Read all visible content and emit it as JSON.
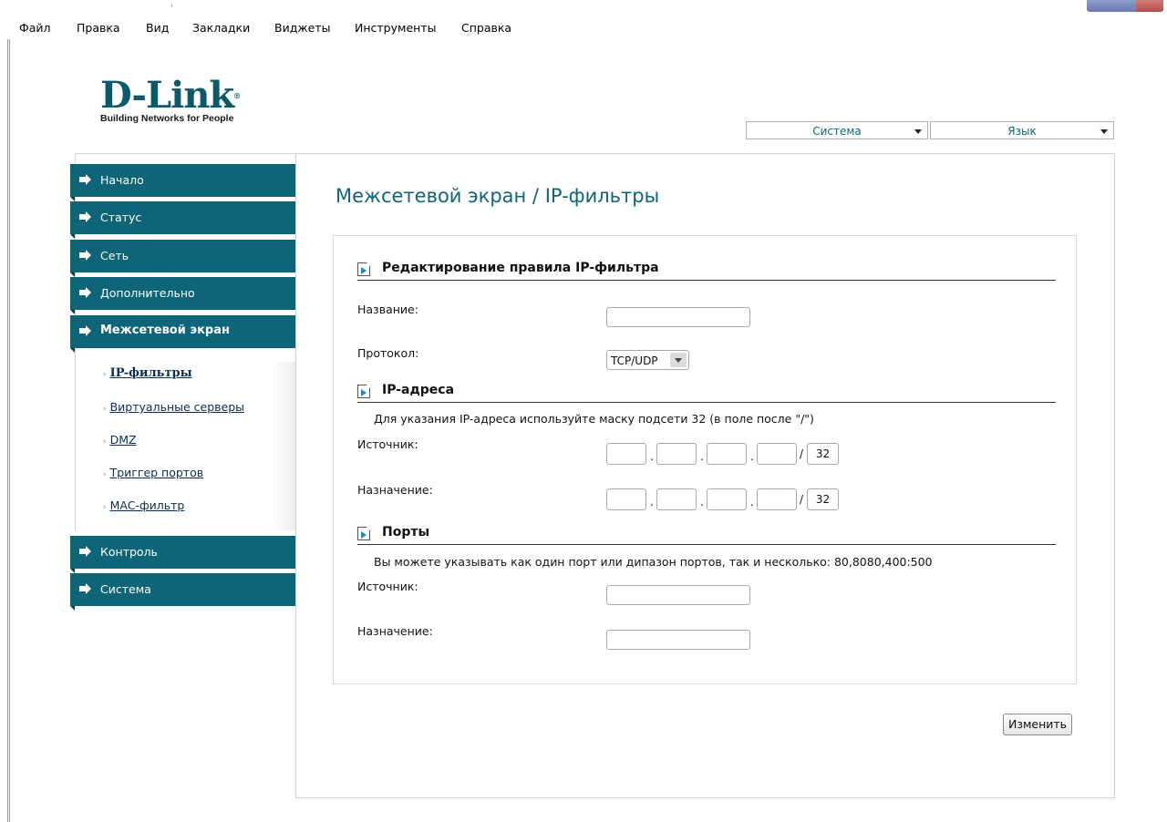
{
  "menubar": {
    "items": [
      "Файл",
      "Правка",
      "Вид",
      "Закладки",
      "Виджеты",
      "Инструменты",
      "Справка"
    ]
  },
  "logo": {
    "main": "D-Link",
    "registered": "®",
    "tagline": "Building Networks for People"
  },
  "top_selects": {
    "system": "Система",
    "language": "Язык"
  },
  "sidebar": {
    "items": [
      {
        "label": "Начало"
      },
      {
        "label": "Статус"
      },
      {
        "label": "Сеть"
      },
      {
        "label": "Дополнительно"
      },
      {
        "label": "Межсетевой экран",
        "active": true
      },
      {
        "label": "Контроль"
      },
      {
        "label": "Система"
      }
    ],
    "subitems": [
      {
        "label": "IP-фильтры",
        "current": true
      },
      {
        "label": "Виртуальные серверы"
      },
      {
        "label": "DMZ"
      },
      {
        "label": "Триггер портов"
      },
      {
        "label": "MAC-фильтр"
      }
    ],
    "bullet": "›"
  },
  "page": {
    "title": "Межсетевой экран / IP-фильтры"
  },
  "form": {
    "section_edit": "Редактирование правила IP-фильтра",
    "name_label": "Название:",
    "name_value": "",
    "protocol_label": "Протокол:",
    "protocol_value": "TCP/UDP",
    "section_ip": "IP-адреса",
    "ip_note": "Для указания IP-адреса используйте маску подсети 32 (в поле после \"/\")",
    "ip_source_label": "Источник:",
    "ip_dest_label": "Назначение:",
    "octet_sep": ".",
    "mask_sep": "/",
    "ip_source_mask": "32",
    "ip_dest_mask": "32",
    "section_ports": "Порты",
    "ports_note": "Вы можете указывать как один порт или дипазон портов, так и несколько: 80,8080,400:500",
    "port_source_label": "Источник:",
    "port_dest_label": "Назначение:",
    "port_source_value": "",
    "port_dest_value": "",
    "submit_label": "Изменить"
  },
  "colors": {
    "accent": "#0e6577",
    "link": "#0b2e4f",
    "icon_arrow": "#1b88c9"
  },
  "icons": {
    "nav_arrow": "arrow-right-icon",
    "section": "section-arrow-icon",
    "dropdown": "chevron-down-icon"
  }
}
